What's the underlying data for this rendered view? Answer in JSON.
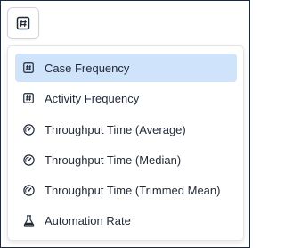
{
  "trigger": {
    "icon": "hash-icon"
  },
  "menu": {
    "items": [
      {
        "label": "Case Frequency",
        "icon": "hash-icon",
        "selected": true
      },
      {
        "label": "Activity Frequency",
        "icon": "hash-icon",
        "selected": false
      },
      {
        "label": "Throughput Time (Average)",
        "icon": "gauge-icon",
        "selected": false
      },
      {
        "label": "Throughput Time (Median)",
        "icon": "gauge-icon",
        "selected": false
      },
      {
        "label": "Throughput Time (Trimmed Mean)",
        "icon": "gauge-icon",
        "selected": false
      },
      {
        "label": "Automation Rate",
        "icon": "flask-icon",
        "selected": false
      }
    ]
  },
  "colors": {
    "selected_bg": "#cfe3fb",
    "text": "#1f2937",
    "border": "#d1d5db"
  }
}
